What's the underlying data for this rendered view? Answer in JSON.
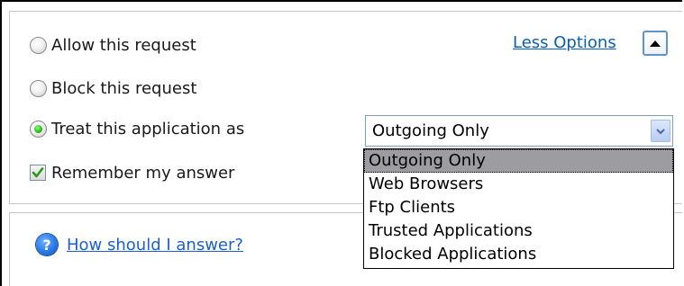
{
  "options": {
    "allow_label": "Allow this request",
    "block_label": "Block this request",
    "treat_label": "Treat this application as",
    "remember_label": "Remember my answer",
    "selected": "treat",
    "remember_checked": true
  },
  "less_options_label": "Less Options",
  "select": {
    "value": "Outgoing Only",
    "options": [
      "Outgoing Only",
      "Web Browsers",
      "Ftp Clients",
      "Trusted Applications",
      "Blocked Applications"
    ]
  },
  "help": {
    "link_label": "How should I answer?"
  },
  "icons": {
    "collapse": "chevron-up-icon",
    "help": "question-icon",
    "dropdown_arrow": "chevron-down-icon",
    "checkmark": "checkmark-icon"
  },
  "colors": {
    "link": "#0a5fb4",
    "radio_checked": "#2fbf1f",
    "selection_bg": "#9d9da1"
  }
}
